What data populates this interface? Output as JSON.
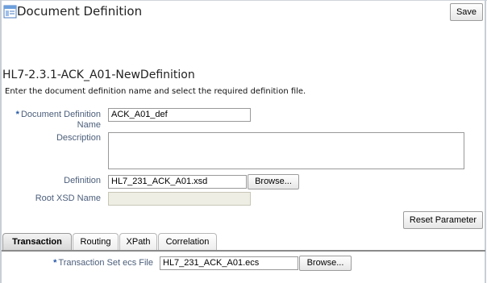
{
  "page": {
    "title": "Document Definition",
    "save_label": "Save"
  },
  "definition": {
    "title": "HL7-2.3.1-ACK_A01-NewDefinition",
    "instructions": "Enter the document definition name and select the required definition file."
  },
  "form": {
    "required_marker": "*",
    "doc_def_name_label_line1": "Document Definition",
    "doc_def_name_label_line2": "Name",
    "doc_def_name_value": "ACK_A01_def",
    "description_label": "Description",
    "description_value": "",
    "definition_label": "Definition",
    "definition_value": "HL7_231_ACK_A01.xsd",
    "browse_label": "Browse...",
    "root_xsd_label": "Root XSD Name",
    "root_xsd_value": "",
    "reset_label": "Reset Parameter"
  },
  "tabs": [
    {
      "label": "Transaction",
      "active": true
    },
    {
      "label": "Routing",
      "active": false
    },
    {
      "label": "XPath",
      "active": false
    },
    {
      "label": "Correlation",
      "active": false
    }
  ],
  "transaction": {
    "ecs_label": "Transaction Set ecs File",
    "ecs_value": "HL7_231_ACK_A01.ecs",
    "browse_label": "Browse..."
  }
}
